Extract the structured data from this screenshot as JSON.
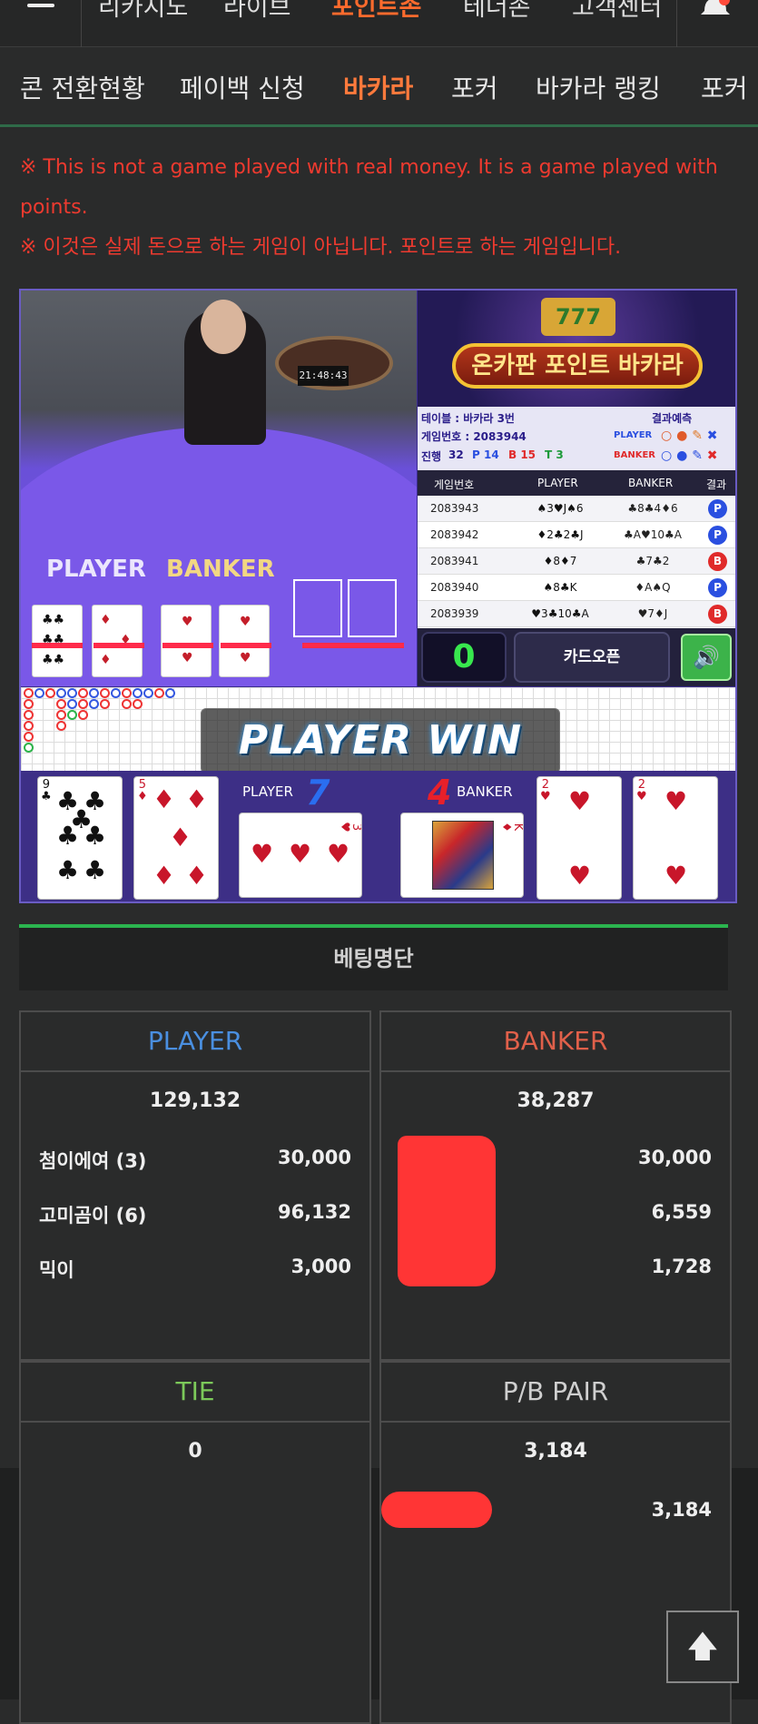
{
  "top_nav": {
    "items": [
      {
        "label": "리카지노",
        "active": false
      },
      {
        "label": "라이브",
        "active": false
      },
      {
        "label": "포인트존",
        "active": true
      },
      {
        "label": "테더존",
        "active": false
      },
      {
        "label": "고객센터",
        "active": false
      }
    ],
    "menu_icon": "hamburger-icon",
    "bell_icon": "bell-icon"
  },
  "sub_nav": {
    "items": [
      {
        "label": "콘 전환현황",
        "active": false
      },
      {
        "label": "페이백 신청",
        "active": false
      },
      {
        "label": "바카라",
        "active": true
      },
      {
        "label": "포커",
        "active": false
      },
      {
        "label": "바카라 랭킹",
        "active": false
      },
      {
        "label": "포커",
        "active": false
      }
    ]
  },
  "notices": {
    "english": "※ This is not a game played with real money. It is a game played with points.",
    "korean": "※ 이것은 실제 돈으로 하는 게임이 아닙니다. 포인트로 하는 게임입니다."
  },
  "video": {
    "clock": "21:48:43",
    "player_label": "PLAYER",
    "banker_label": "BANKER"
  },
  "side_panel": {
    "banner_title": "온카판 포인트 바카라",
    "slot_text": "777",
    "table_label": "테이블 : 바카라 3번",
    "game_number_label": "게임번호 : 2083944",
    "progress_label": "진행",
    "progress_count": "32",
    "p_count": "P 14",
    "b_count": "B 15",
    "t_count": "T 3",
    "prediction_label": "결과예측",
    "player_word": "PLAYER",
    "banker_word": "BANKER",
    "results_header": {
      "game_no": "게임번호",
      "player": "PLAYER",
      "banker": "BANKER",
      "result": "결과"
    },
    "results": [
      {
        "game_no": "2083943",
        "player": "♠3♥J♠6",
        "banker": "♣8♣4♦6",
        "result": "P"
      },
      {
        "game_no": "2083942",
        "player": "♦2♣2♣J",
        "banker": "♣A♥10♣A",
        "result": "P"
      },
      {
        "game_no": "2083941",
        "player": "♦8♦7",
        "banker": "♣7♣2",
        "result": "B"
      },
      {
        "game_no": "2083940",
        "player": "♠8♣K",
        "banker": "♦A♠Q",
        "result": "P"
      },
      {
        "game_no": "2083939",
        "player": "♥3♣10♣A",
        "banker": "♥7♦J",
        "result": "B"
      }
    ],
    "countdown": "0",
    "card_open_button": "카드오픈",
    "sound_icon": "speaker-icon"
  },
  "result_banner": "PLAYER WIN",
  "score": {
    "player_label": "PLAYER",
    "player_score": "7",
    "banker_label": "BANKER",
    "banker_score": "4"
  },
  "cards": {
    "player": [
      {
        "rank": "9",
        "suit": "♣"
      },
      {
        "rank": "5",
        "suit": "♦"
      },
      {
        "rank": "3",
        "suit": "♥"
      }
    ],
    "banker": [
      {
        "rank": "K",
        "suit": "♦"
      },
      {
        "rank": "2",
        "suit": "♥"
      },
      {
        "rank": "2",
        "suit": "♥"
      }
    ]
  },
  "betting": {
    "title": "베팅명단",
    "player": {
      "label": "PLAYER",
      "total": "129,132",
      "entries": [
        {
          "name": "첨이에여 (3)",
          "amount": "30,000"
        },
        {
          "name": "고미곰이 (6)",
          "amount": "96,132"
        },
        {
          "name": "믹이",
          "amount": "3,000"
        }
      ]
    },
    "banker": {
      "label": "BANKER",
      "total": "38,287",
      "entries": [
        {
          "amount": "30,000"
        },
        {
          "amount": "6,559"
        },
        {
          "amount": "1,728"
        }
      ]
    },
    "tie": {
      "label": "TIE",
      "total": "0"
    },
    "pair": {
      "label": "P/B PAIR",
      "total": "3,184",
      "entries": [
        {
          "amount": "3,184"
        }
      ]
    }
  },
  "colors": {
    "accent_orange": "#ff6b2d",
    "notice_red": "#ee3a2f",
    "player_blue": "#4a8fe0",
    "banker_red": "#e0604a",
    "tie_green": "#7cc95a",
    "pair_gray": "#cfcfcf",
    "divider_green": "#2bb44f"
  },
  "scroll_top_icon": "arrow-up-icon"
}
